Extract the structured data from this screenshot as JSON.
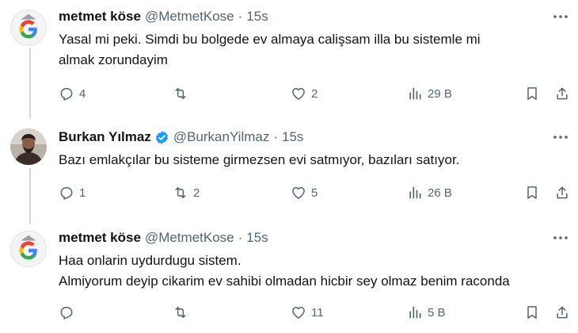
{
  "tweets": [
    {
      "name": "metmet köse",
      "handle": "@MetmetKose",
      "separator": "·",
      "time": "15s",
      "text_lines": [
        "Yasal mi peki. Simdi bu bolgede ev almaya calişsam illa bu sistemle mi",
        "almak zorundayim"
      ],
      "avatar_icon": "google-logo-icon",
      "verified": false,
      "actions": {
        "replies": "4",
        "retweets": "",
        "likes": "2",
        "views": "29 B"
      }
    },
    {
      "name": "Burkan Yılmaz",
      "handle": "@BurkanYilmaz",
      "separator": "·",
      "time": "15s",
      "text_lines": [
        "Bazı emlakçılar bu sisteme girmezsen evi satmıyor, bazıları satıyor."
      ],
      "avatar_icon": "user-photo-icon",
      "verified": true,
      "actions": {
        "replies": "1",
        "retweets": "2",
        "likes": "5",
        "views": "26 B"
      }
    },
    {
      "name": "metmet köse",
      "handle": "@MetmetKose",
      "separator": "·",
      "time": "15s",
      "text_lines": [
        "Haa onlarin uydurdugu sistem.",
        "Almiyorum deyip cikarim ev sahibi olmadan hicbir sey olmaz benim raconda"
      ],
      "avatar_icon": "google-logo-icon",
      "verified": false,
      "actions": {
        "replies": "",
        "retweets": "",
        "likes": "11",
        "views": "5 B"
      }
    }
  ],
  "colors": {
    "text": "#0f1419",
    "secondary": "#536471",
    "verified": "#1d9bf0",
    "thread_line": "#cfd9de"
  }
}
